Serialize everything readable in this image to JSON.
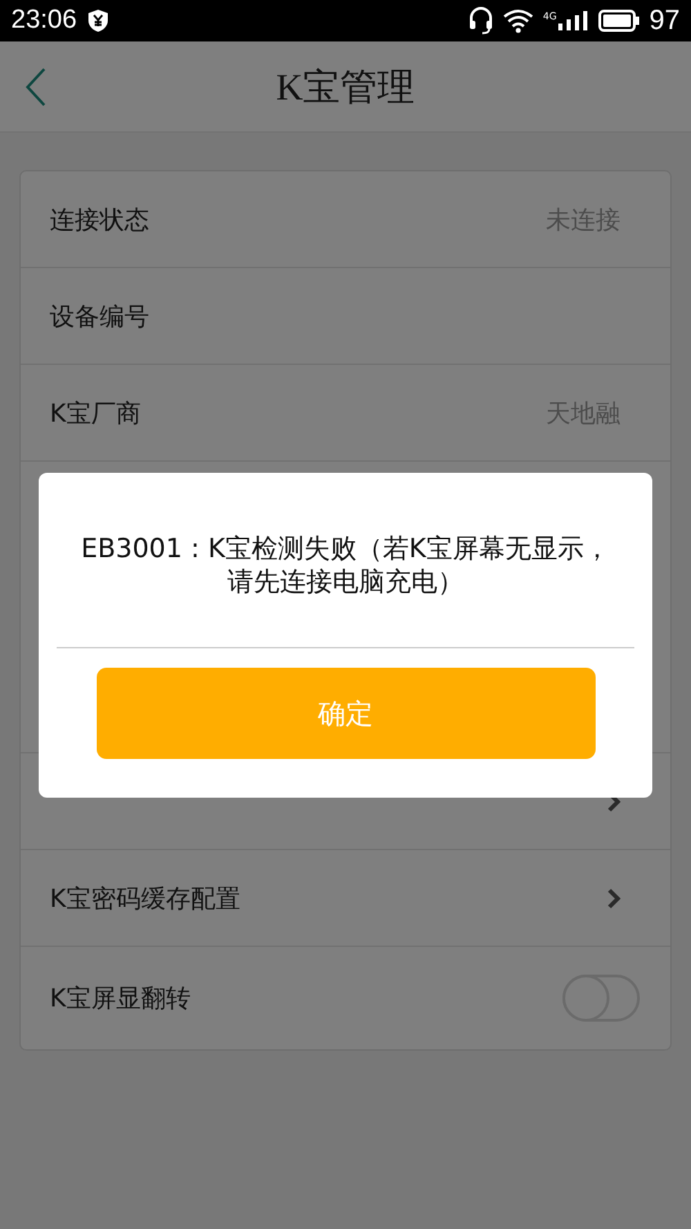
{
  "status_bar": {
    "time": "23:06",
    "network_type": "4G",
    "battery": "97"
  },
  "header": {
    "title": "K宝管理"
  },
  "settings_top": [
    {
      "kind": "value",
      "label": "连接状态",
      "value": "未连接"
    },
    {
      "kind": "plain",
      "label": "设备编号"
    },
    {
      "kind": "value",
      "label": "K宝厂商",
      "value": "天地融"
    }
  ],
  "settings_bottom": [
    {
      "kind": "chevron"
    },
    {
      "kind": "chevron",
      "label": "K宝密码缓存配置"
    },
    {
      "kind": "toggle",
      "label": "K宝屏显翻转",
      "on": false
    }
  ],
  "dialog": {
    "message": "EB3001 : K宝检测失败（若K宝屏幕无显示，请先连接电脑充电）",
    "button": "确定"
  }
}
